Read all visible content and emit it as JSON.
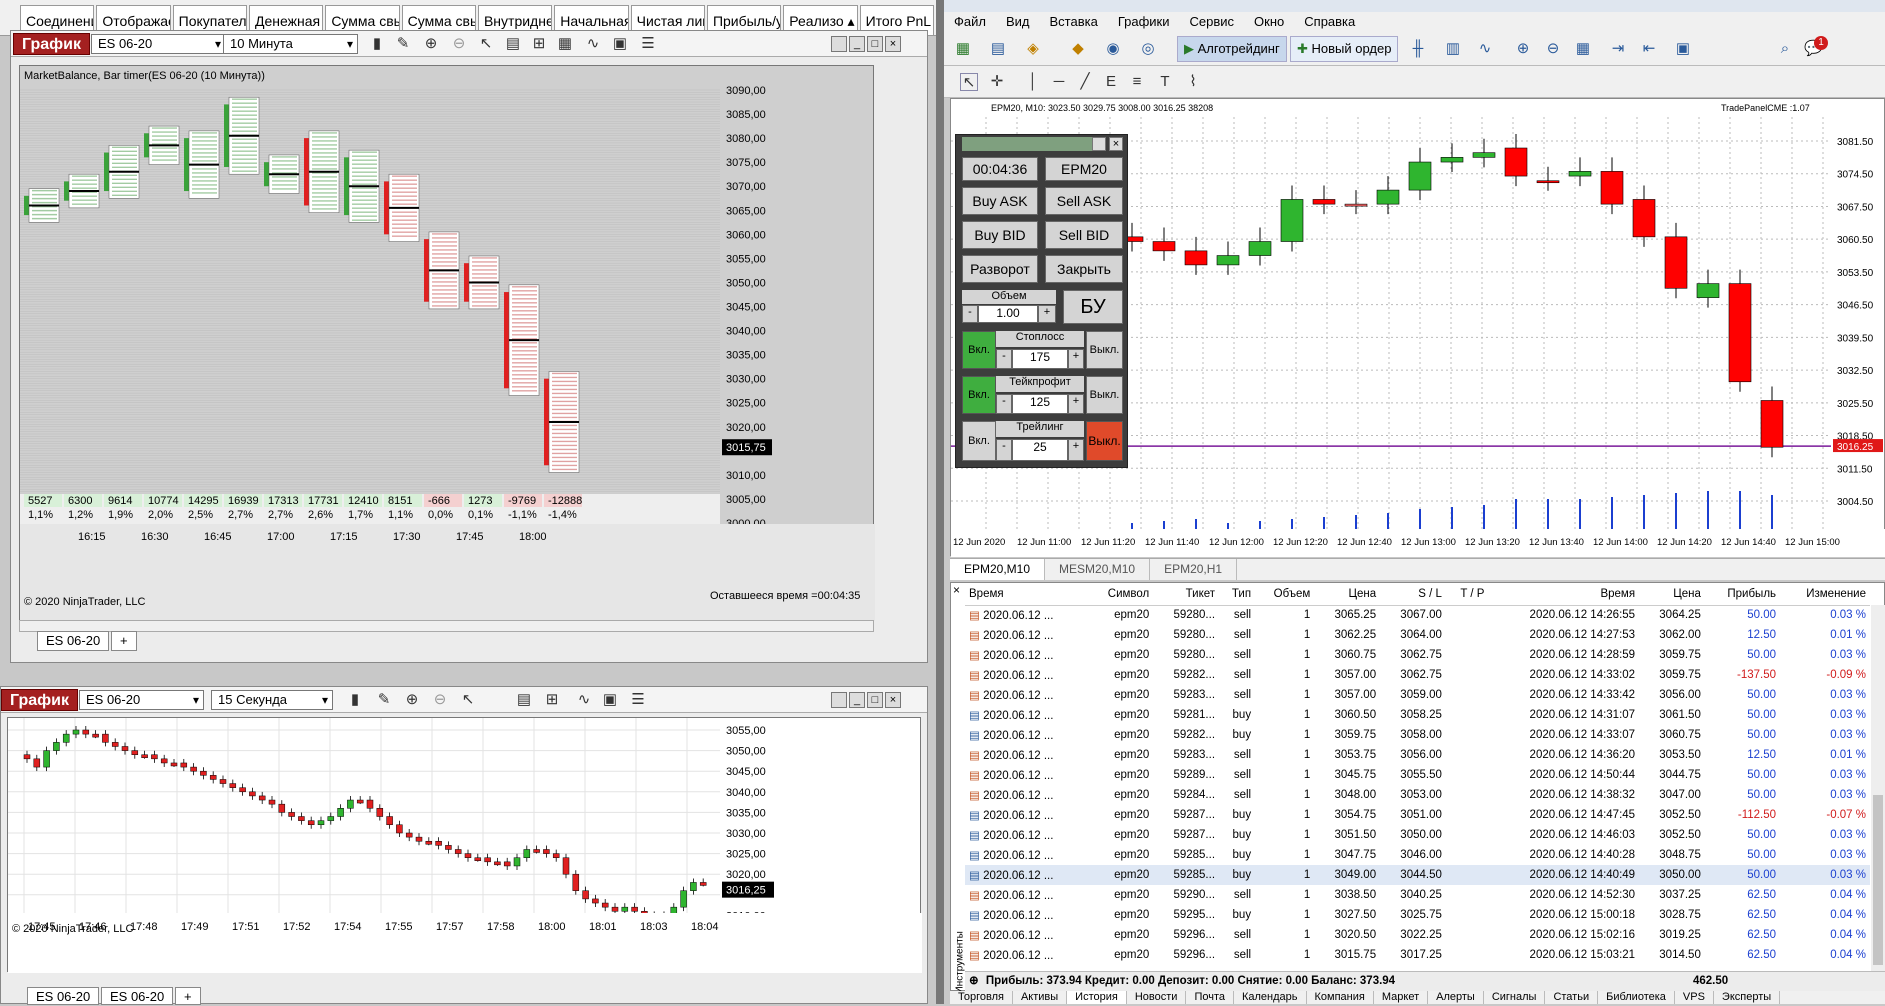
{
  "nt_tabs": [
    "Соединени",
    "Отображае",
    "Покупатель",
    "Денежная",
    "Сумма свы",
    "Сумма свы",
    "Внутридне",
    "Начальная",
    "Чистая лик",
    "Прибыль/у",
    "Реализо ▴",
    "Итого PnL"
  ],
  "top_chart": {
    "badge": "График",
    "instrument": "ES 06-20",
    "interval": "10 Минута",
    "indicator_title": "MarketBalance, Bar timer(ES 06-20 (10 Минута))",
    "price_ticks": [
      "3090,00",
      "3085,00",
      "3080,00",
      "3075,00",
      "3070,00",
      "3065,00",
      "3060,00",
      "3055,00",
      "3050,00",
      "3045,00",
      "3040,00",
      "3035,00",
      "3030,00",
      "3025,00",
      "3020,00",
      "3015,75",
      "3010,00",
      "3005,00",
      "3000,00"
    ],
    "current_price": "3015,75",
    "time_labels": [
      "16:15",
      "16:30",
      "16:45",
      "17:00",
      "17:15",
      "17:30",
      "17:45",
      "18:00"
    ],
    "delta_values": [
      "5527",
      "6300",
      "9614",
      "10774",
      "14295",
      "16939",
      "17313",
      "17731",
      "12410",
      "8151",
      "-666",
      "1273",
      "-9769",
      "-12888"
    ],
    "delta_pct": [
      "1,1%",
      "1,2%",
      "1,9%",
      "2,0%",
      "2,5%",
      "2,7%",
      "2,7%",
      "2,6%",
      "1,7%",
      "1,1%",
      "0,0%",
      "0,1%",
      "-1,1%",
      "-1,4%"
    ],
    "copyright": "© 2020 NinjaTrader, LLC",
    "remaining": "Оставшееся время =00:04:35",
    "tab": "ES 06-20",
    "add_tab": "+"
  },
  "bottom_chart": {
    "badge": "График",
    "instrument": "ES 06-20",
    "interval": "15 Секунда",
    "price_ticks": [
      "3055,00",
      "3050,00",
      "3045,00",
      "3040,00",
      "3035,00",
      "3030,00",
      "3025,00",
      "3020,00",
      "3016,25",
      "3010,00"
    ],
    "current_price": "3016,25",
    "time_labels": [
      "17:45",
      "17:46",
      "17:48",
      "17:49",
      "17:51",
      "17:52",
      "17:54",
      "17:55",
      "17:57",
      "17:58",
      "18:00",
      "18:01",
      "18:03",
      "18:04"
    ],
    "copyright": "© 2020 NinjaTrader, LLC",
    "tabs": [
      "ES 06-20",
      "ES 06-20"
    ],
    "add_tab": "+"
  },
  "mt": {
    "menu": [
      "Файл",
      "Вид",
      "Вставка",
      "Графики",
      "Сервис",
      "Окно",
      "Справка"
    ],
    "algo_label": "Алготрейдинг",
    "new_order_label": "Новый ордер",
    "notif_count": "1",
    "chart_header": "EPM20, M10: 3023.50 3029.75 3008.00 3016.25 38208",
    "chart_right_label": "TradePanelCME :1.07",
    "price_ticks": [
      "3081.50",
      "3074.50",
      "3067.50",
      "3060.50",
      "3053.50",
      "3046.50",
      "3039.50",
      "3032.50",
      "3025.50",
      "3018.50",
      "3016.25",
      "3011.50",
      "3004.50"
    ],
    "current_price": "3016.25",
    "time_labels": [
      "12 Jun 2020",
      "12 Jun 11:00",
      "12 Jun 11:20",
      "12 Jun 11:40",
      "12 Jun 12:00",
      "12 Jun 12:20",
      "12 Jun 12:40",
      "12 Jun 13:00",
      "12 Jun 13:20",
      "12 Jun 13:40",
      "12 Jun 14:00",
      "12 Jun 14:20",
      "12 Jun 14:40",
      "12 Jun 15:00"
    ],
    "chart_tabs": [
      "EPM20,M10",
      "MESM20,M10",
      "EPM20,H1"
    ],
    "panel": {
      "timer": "00:04:36",
      "symbol": "EPM20",
      "buy_ask": "Buy ASK",
      "sell_ask": "Sell ASK",
      "buy_bid": "Buy BID",
      "sell_bid": "Sell BID",
      "reverse": "Разворот",
      "close": "Закрыть",
      "volume_label": "Объем",
      "volume": "1.00",
      "bu": "БУ",
      "on": "Вкл.",
      "off": "Выкл.",
      "sl_label": "Стоплосс",
      "sl": "175",
      "tp_label": "Тейкпрофит",
      "tp": "125",
      "trail_label": "Трейлинг",
      "trail": "25",
      "minus": "-",
      "plus": "+"
    },
    "table_headers": [
      "Время",
      "Символ",
      "Тикет",
      "Тип",
      "Объем",
      "Цена",
      "S / L",
      "T / P",
      "Время",
      "Цена",
      "Прибыль",
      "Изменение"
    ],
    "rows": [
      [
        "2020.06.12 ...",
        "epm20",
        "59280...",
        "sell",
        "1",
        "3065.25",
        "3067.00",
        "",
        "2020.06.12 14:26:55",
        "3064.25",
        "50.00",
        "0.03 %"
      ],
      [
        "2020.06.12 ...",
        "epm20",
        "59280...",
        "sell",
        "1",
        "3062.25",
        "3064.00",
        "",
        "2020.06.12 14:27:53",
        "3062.00",
        "12.50",
        "0.01 %"
      ],
      [
        "2020.06.12 ...",
        "epm20",
        "59280...",
        "sell",
        "1",
        "3060.75",
        "3062.75",
        "",
        "2020.06.12 14:28:59",
        "3059.75",
        "50.00",
        "0.03 %"
      ],
      [
        "2020.06.12 ...",
        "epm20",
        "59282...",
        "sell",
        "1",
        "3057.00",
        "3062.75",
        "",
        "2020.06.12 14:33:02",
        "3059.75",
        "-137.50",
        "-0.09 %"
      ],
      [
        "2020.06.12 ...",
        "epm20",
        "59283...",
        "sell",
        "1",
        "3057.00",
        "3059.00",
        "",
        "2020.06.12 14:33:42",
        "3056.00",
        "50.00",
        "0.03 %"
      ],
      [
        "2020.06.12 ...",
        "epm20",
        "59281...",
        "buy",
        "1",
        "3060.50",
        "3058.25",
        "",
        "2020.06.12 14:31:07",
        "3061.50",
        "50.00",
        "0.03 %"
      ],
      [
        "2020.06.12 ...",
        "epm20",
        "59282...",
        "buy",
        "1",
        "3059.75",
        "3058.00",
        "",
        "2020.06.12 14:33:07",
        "3060.75",
        "50.00",
        "0.03 %"
      ],
      [
        "2020.06.12 ...",
        "epm20",
        "59283...",
        "sell",
        "1",
        "3053.75",
        "3056.00",
        "",
        "2020.06.12 14:36:20",
        "3053.50",
        "12.50",
        "0.01 %"
      ],
      [
        "2020.06.12 ...",
        "epm20",
        "59289...",
        "sell",
        "1",
        "3045.75",
        "3055.50",
        "",
        "2020.06.12 14:50:44",
        "3044.75",
        "50.00",
        "0.03 %"
      ],
      [
        "2020.06.12 ...",
        "epm20",
        "59284...",
        "sell",
        "1",
        "3048.00",
        "3053.00",
        "",
        "2020.06.12 14:38:32",
        "3047.00",
        "50.00",
        "0.03 %"
      ],
      [
        "2020.06.12 ...",
        "epm20",
        "59287...",
        "buy",
        "1",
        "3054.75",
        "3051.00",
        "",
        "2020.06.12 14:47:45",
        "3052.50",
        "-112.50",
        "-0.07 %"
      ],
      [
        "2020.06.12 ...",
        "epm20",
        "59287...",
        "buy",
        "1",
        "3051.50",
        "3050.00",
        "",
        "2020.06.12 14:46:03",
        "3052.50",
        "50.00",
        "0.03 %"
      ],
      [
        "2020.06.12 ...",
        "epm20",
        "59285...",
        "buy",
        "1",
        "3047.75",
        "3046.00",
        "",
        "2020.06.12 14:40:28",
        "3048.75",
        "50.00",
        "0.03 %"
      ],
      [
        "2020.06.12 ...",
        "epm20",
        "59285...",
        "buy",
        "1",
        "3049.00",
        "3044.50",
        "",
        "2020.06.12 14:40:49",
        "3050.00",
        "50.00",
        "0.03 %"
      ],
      [
        "2020.06.12 ...",
        "epm20",
        "59290...",
        "sell",
        "1",
        "3038.50",
        "3040.25",
        "",
        "2020.06.12 14:52:30",
        "3037.25",
        "62.50",
        "0.04 %"
      ],
      [
        "2020.06.12 ...",
        "epm20",
        "59295...",
        "buy",
        "1",
        "3027.50",
        "3025.75",
        "",
        "2020.06.12 15:00:18",
        "3028.75",
        "62.50",
        "0.04 %"
      ],
      [
        "2020.06.12 ...",
        "epm20",
        "59296...",
        "sell",
        "1",
        "3020.50",
        "3022.25",
        "",
        "2020.06.12 15:02:16",
        "3019.25",
        "62.50",
        "0.04 %"
      ],
      [
        "2020.06.12 ...",
        "epm20",
        "59296...",
        "sell",
        "1",
        "3015.75",
        "3017.25",
        "",
        "2020.06.12 15:03:21",
        "3014.50",
        "62.50",
        "0.04 %"
      ]
    ],
    "summary": "Прибыль: 373.94  Кредит: 0.00  Депозит: 0.00  Снятие: 0.00  Баланс: 373.94",
    "summary_total": "462.50",
    "side_label": "Инструменты",
    "bottom_tabs": [
      "Торговля",
      "Активы",
      "История",
      "Новости",
      "Почта",
      "Календарь",
      "Компания",
      "Маркет",
      "Алерты",
      "Сигналы",
      "Статьи",
      "Библиотека",
      "VPS",
      "Эксперты"
    ]
  }
}
